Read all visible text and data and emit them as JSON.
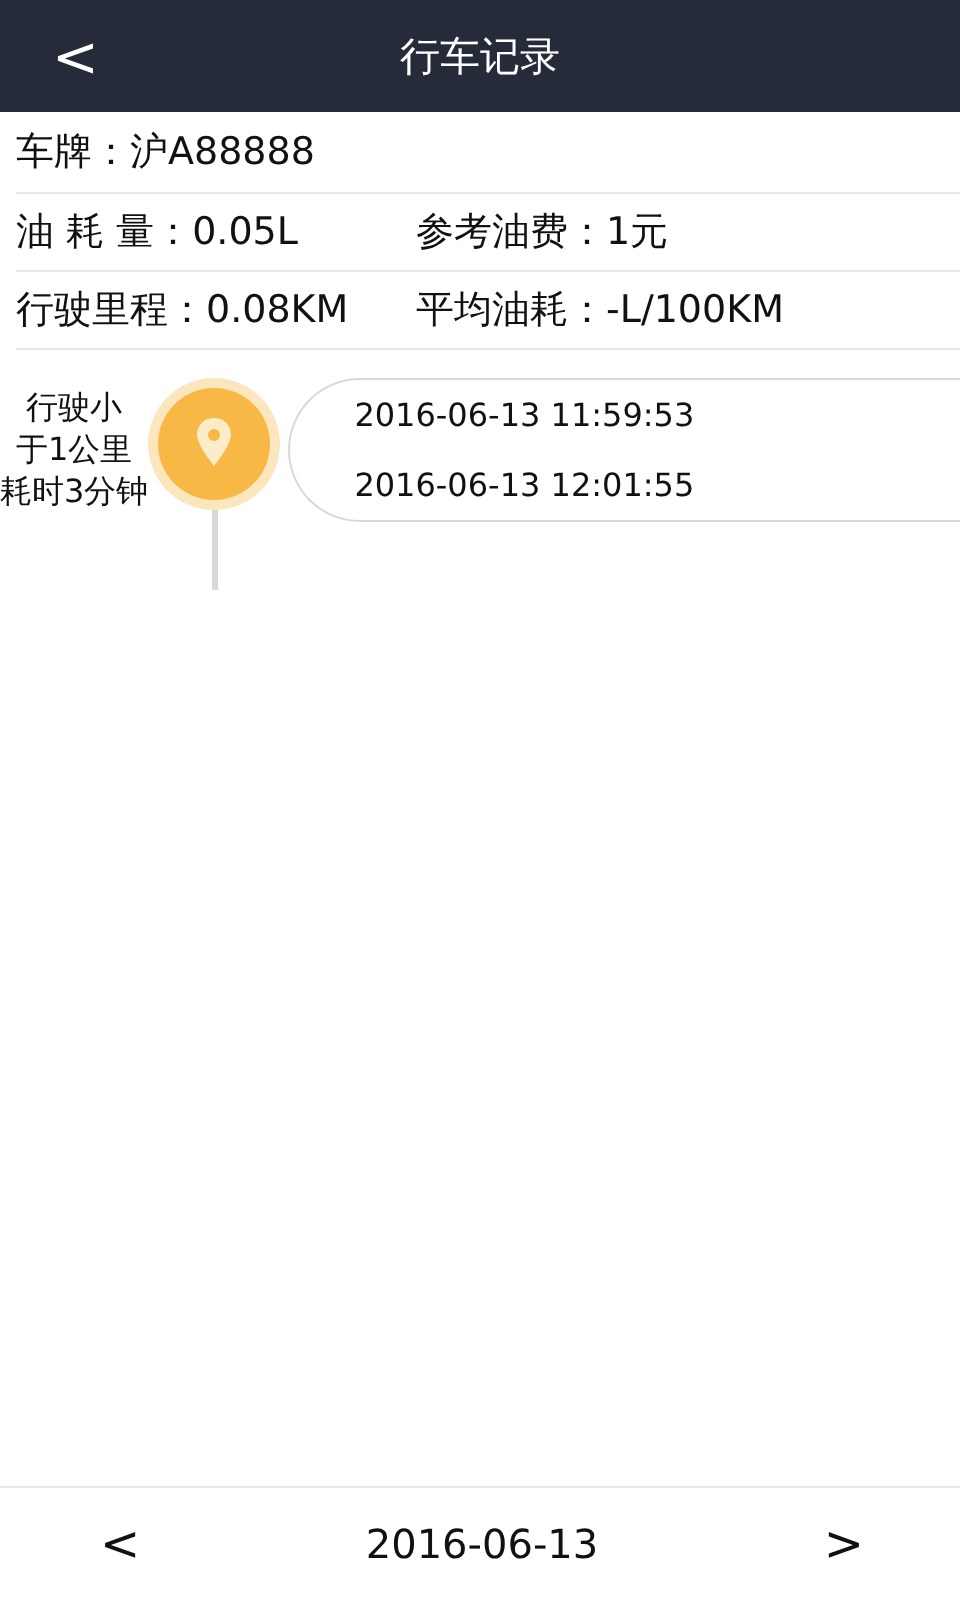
{
  "header": {
    "back": "<",
    "title": "行车记录"
  },
  "plate": {
    "label": "车牌：",
    "value": "沪A88888"
  },
  "stats": [
    [
      {
        "label": "油 耗 量：",
        "value": "0.05L"
      },
      {
        "label": "参考油费：",
        "value": "1元"
      }
    ],
    [
      {
        "label": "行驶里程：",
        "value": "0.08KM"
      },
      {
        "label": "平均油耗：",
        "value": "-L/100KM"
      }
    ]
  ],
  "trips": [
    {
      "summary_lines": [
        "行驶小",
        "于1公里",
        "耗时3分钟"
      ],
      "start": "2016-06-13 11:59:53",
      "end": "2016-06-13 12:01:55"
    }
  ],
  "footer": {
    "prev": "<",
    "date": "2016-06-13",
    "next": ">"
  }
}
